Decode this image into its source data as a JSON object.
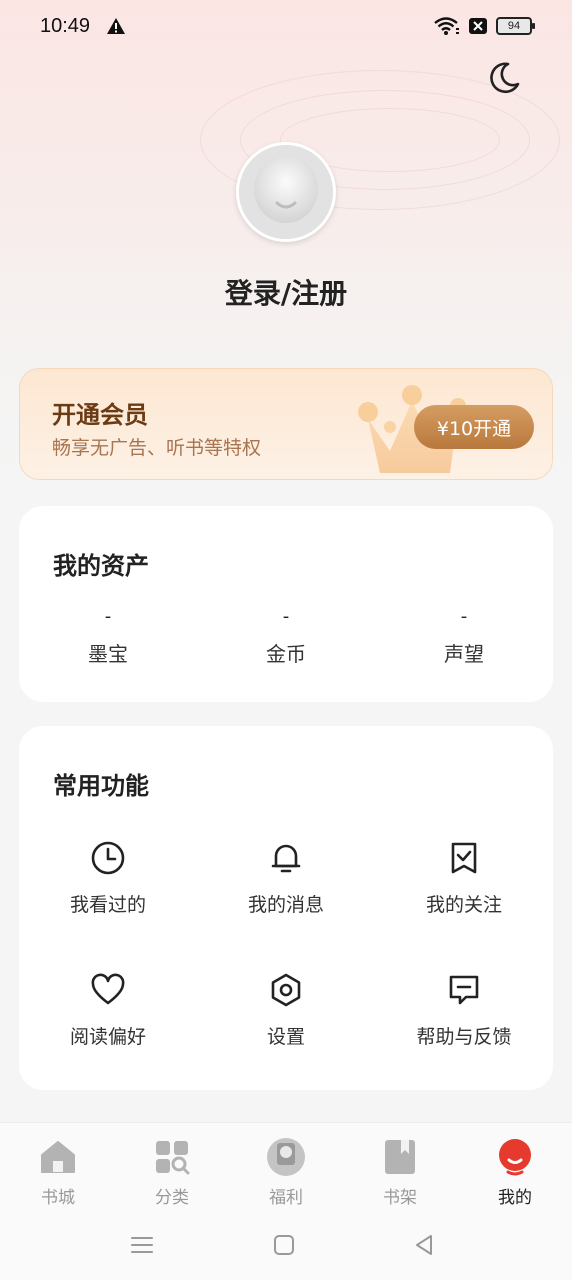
{
  "status": {
    "time": "10:49",
    "battery": "94"
  },
  "profile": {
    "login_text": "登录/注册"
  },
  "vip": {
    "title": "开通会员",
    "subtitle": "畅享无广告、听书等特权",
    "button": "¥10开通"
  },
  "assets": {
    "title": "我的资产",
    "items": [
      {
        "value": "-",
        "label": "墨宝"
      },
      {
        "value": "-",
        "label": "金币"
      },
      {
        "value": "-",
        "label": "声望"
      }
    ]
  },
  "functions": {
    "title": "常用功能",
    "items": [
      {
        "label": "我看过的",
        "icon": "clock-icon"
      },
      {
        "label": "我的消息",
        "icon": "bell-icon"
      },
      {
        "label": "我的关注",
        "icon": "bookmark-check-icon"
      },
      {
        "label": "阅读偏好",
        "icon": "heart-icon"
      },
      {
        "label": "设置",
        "icon": "gear-icon"
      },
      {
        "label": "帮助与反馈",
        "icon": "feedback-icon"
      }
    ]
  },
  "tabbar": {
    "items": [
      {
        "label": "书城",
        "icon": "home-icon"
      },
      {
        "label": "分类",
        "icon": "category-icon"
      },
      {
        "label": "福利",
        "icon": "gift-icon"
      },
      {
        "label": "书架",
        "icon": "bookshelf-icon"
      },
      {
        "label": "我的",
        "icon": "profile-icon"
      }
    ],
    "active": "我的"
  },
  "colors": {
    "accent": "#e63a2e",
    "vip_button": "#c68548"
  }
}
